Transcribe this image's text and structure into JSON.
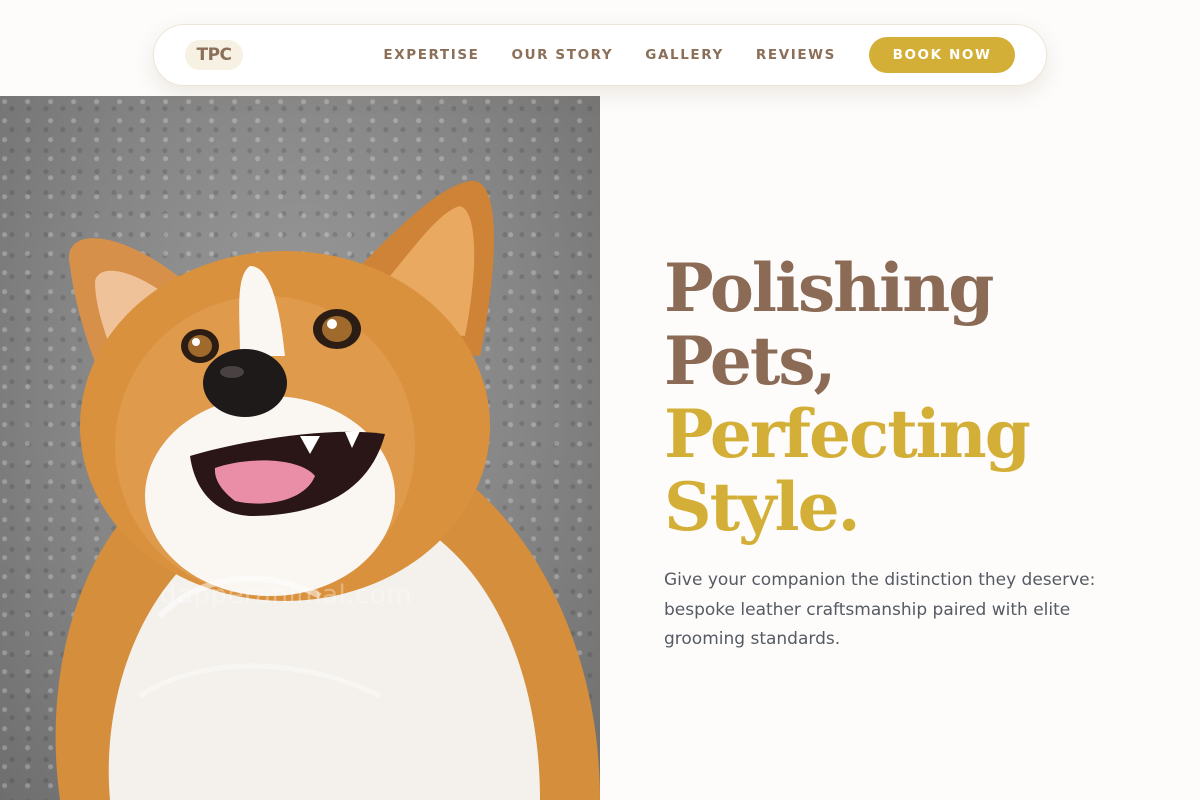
{
  "nav": {
    "logo": "TPC",
    "links": [
      "EXPERTISE",
      "OUR STORY",
      "GALLERY",
      "REVIEWS"
    ],
    "cta": "BOOK NOW"
  },
  "hero": {
    "image_subject": "corgi-dog-portrait",
    "watermark": "dapperanimal.com",
    "headline": {
      "line1": "Polishing",
      "line2": "Pets,",
      "line3": "Perfecting",
      "line4": "Style."
    },
    "subtitle": "Give your companion the distinction they deserve: bespoke leather craftsmanship paired with elite grooming standards."
  },
  "colors": {
    "brand_brown": "#8b6b55",
    "brand_gold": "#d4af37",
    "text_gray": "#555a63",
    "background": "#fdfcfb"
  }
}
